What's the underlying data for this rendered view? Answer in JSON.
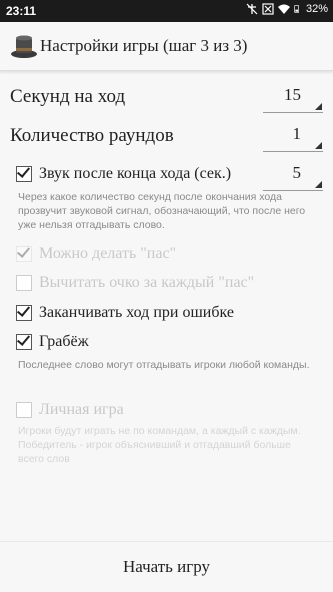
{
  "status": {
    "time": "23:11",
    "battery": "32%"
  },
  "header": {
    "title": "Настройки игры (шаг 3 из 3)",
    "icon": "top-hat-icon"
  },
  "settings": {
    "seconds_per_turn": {
      "label": "Секунд на ход",
      "value": "15"
    },
    "rounds": {
      "label": "Количество раундов",
      "value": "1"
    },
    "sound_after_turn": {
      "label": "Звук после конца хода (сек.)",
      "checked": true,
      "value": "5",
      "description": "Через какое количество секунд после окончания хода прозвучит звуковой сигнал, обозначающий, что после него уже нельзя отгадывать слово."
    },
    "allow_pass": {
      "label": "Можно делать \"пас\"",
      "checked": true,
      "enabled": false
    },
    "deduct_pass": {
      "label": "Вычитать очко за каждый \"пас\"",
      "checked": false,
      "enabled": false
    },
    "end_on_error": {
      "label": "Заканчивать ход при ошибке",
      "checked": true,
      "enabled": true
    },
    "robbery": {
      "label": "Грабёж",
      "checked": true,
      "enabled": true,
      "description": "Последнее слово могут отгадывать игроки любой команды."
    },
    "personal_game": {
      "label": "Личная игра",
      "checked": false,
      "enabled": false,
      "description": "Игроки будут играть не по командам, а каждый с каждым. Победитель - игрок объяснивший и отгадавший больше всего слов"
    }
  },
  "footer": {
    "start_label": "Начать игру"
  }
}
